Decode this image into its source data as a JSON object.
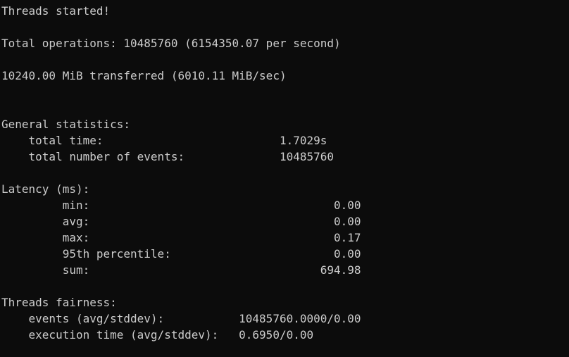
{
  "terminal": {
    "lines": [
      "Threads started!",
      "",
      "Total operations: 10485760 (6154350.07 per second)",
      "",
      "10240.00 MiB transferred (6010.11 MiB/sec)",
      "",
      "",
      "General statistics:",
      "    total time:                          1.7029s",
      "    total number of events:              10485760",
      "",
      "Latency (ms):",
      "         min:                                    0.00",
      "         avg:                                    0.00",
      "         max:                                    0.17",
      "         95th percentile:                        0.00",
      "         sum:                                  694.98",
      "",
      "Threads fairness:",
      "    events (avg/stddev):           10485760.0000/0.00",
      "    execution time (avg/stddev):   0.6950/0.00"
    ]
  }
}
